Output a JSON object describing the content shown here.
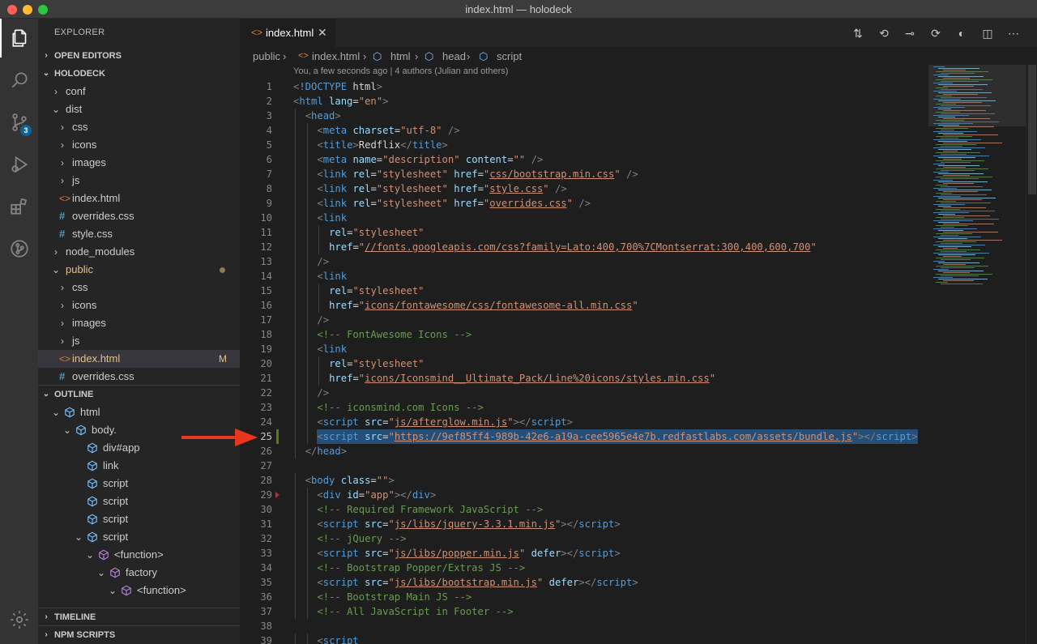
{
  "window": {
    "title": "index.html — holodeck"
  },
  "activity": {
    "scm_badge": "3"
  },
  "sidebar": {
    "header": "EXPLORER",
    "open_editors": "OPEN EDITORS",
    "project": "HOLODECK",
    "tree": [
      {
        "label": "conf",
        "kind": "folder",
        "open": false,
        "depth": 1
      },
      {
        "label": "dist",
        "kind": "folder",
        "open": true,
        "depth": 1
      },
      {
        "label": "css",
        "kind": "folder",
        "open": false,
        "depth": 2
      },
      {
        "label": "icons",
        "kind": "folder",
        "open": false,
        "depth": 2
      },
      {
        "label": "images",
        "kind": "folder",
        "open": false,
        "depth": 2
      },
      {
        "label": "js",
        "kind": "folder",
        "open": false,
        "depth": 2
      },
      {
        "label": "index.html",
        "kind": "html",
        "depth": 2
      },
      {
        "label": "overrides.css",
        "kind": "css",
        "depth": 2
      },
      {
        "label": "style.css",
        "kind": "css",
        "depth": 2
      },
      {
        "label": "node_modules",
        "kind": "folder",
        "open": false,
        "depth": 1
      },
      {
        "label": "public",
        "kind": "folder",
        "open": true,
        "depth": 1,
        "modified": true
      },
      {
        "label": "css",
        "kind": "folder",
        "open": false,
        "depth": 2
      },
      {
        "label": "icons",
        "kind": "folder",
        "open": false,
        "depth": 2
      },
      {
        "label": "images",
        "kind": "folder",
        "open": false,
        "depth": 2
      },
      {
        "label": "js",
        "kind": "folder",
        "open": false,
        "depth": 2
      },
      {
        "label": "index.html",
        "kind": "html",
        "depth": 2,
        "selected": true,
        "flag": "M"
      },
      {
        "label": "overrides.css",
        "kind": "css",
        "depth": 2
      }
    ],
    "outline_title": "OUTLINE",
    "outline": [
      {
        "label": "html",
        "depth": 1,
        "open": true,
        "icon": "element"
      },
      {
        "label": "body.",
        "depth": 2,
        "open": true,
        "icon": "element"
      },
      {
        "label": "div#app",
        "depth": 3,
        "icon": "element"
      },
      {
        "label": "link",
        "depth": 3,
        "icon": "element"
      },
      {
        "label": "script",
        "depth": 3,
        "icon": "element"
      },
      {
        "label": "script",
        "depth": 3,
        "icon": "element"
      },
      {
        "label": "script",
        "depth": 3,
        "icon": "element"
      },
      {
        "label": "script",
        "depth": 3,
        "open": true,
        "icon": "element"
      },
      {
        "label": "<function>",
        "depth": 4,
        "open": true,
        "icon": "function"
      },
      {
        "label": "factory",
        "depth": 5,
        "open": true,
        "icon": "function"
      },
      {
        "label": "<function>",
        "depth": 6,
        "open": true,
        "icon": "function"
      }
    ],
    "timeline": "TIMELINE",
    "npm_scripts": "NPM SCRIPTS"
  },
  "tab": {
    "label": "index.html"
  },
  "breadcrumb": [
    "public",
    "index.html",
    "html",
    "head",
    "script"
  ],
  "codelens": "You, a few seconds ago | 4 authors (Julian and others)",
  "colors": {
    "accent": "#0e639c",
    "selection": "#264f78",
    "arrow": "#e8361e"
  },
  "code_lines": [
    {
      "n": "1",
      "indent": 0,
      "tokens": [
        [
          "p",
          "<"
        ],
        [
          "k",
          "!DOCTYPE"
        ],
        [
          "d",
          " html"
        ],
        [
          "p",
          ">"
        ]
      ]
    },
    {
      "n": "2",
      "indent": 0,
      "tokens": [
        [
          "p",
          "<"
        ],
        [
          "k",
          "html"
        ],
        [
          "d",
          " "
        ],
        [
          "a",
          "lang"
        ],
        [
          "d",
          "="
        ],
        [
          "s",
          "\"en\""
        ],
        [
          "p",
          ">"
        ]
      ]
    },
    {
      "n": "3",
      "indent": 1,
      "tokens": [
        [
          "p",
          "<"
        ],
        [
          "k",
          "head"
        ],
        [
          "p",
          ">"
        ]
      ]
    },
    {
      "n": "4",
      "indent": 2,
      "tokens": [
        [
          "p",
          "<"
        ],
        [
          "k",
          "meta"
        ],
        [
          "d",
          " "
        ],
        [
          "a",
          "charset"
        ],
        [
          "d",
          "="
        ],
        [
          "s",
          "\"utf-8\""
        ],
        [
          "d",
          " "
        ],
        [
          "p",
          "/>"
        ]
      ]
    },
    {
      "n": "5",
      "indent": 2,
      "tokens": [
        [
          "p",
          "<"
        ],
        [
          "k",
          "title"
        ],
        [
          "p",
          ">"
        ],
        [
          "d",
          "Redflix"
        ],
        [
          "p",
          "</"
        ],
        [
          "k",
          "title"
        ],
        [
          "p",
          ">"
        ]
      ]
    },
    {
      "n": "6",
      "indent": 2,
      "tokens": [
        [
          "p",
          "<"
        ],
        [
          "k",
          "meta"
        ],
        [
          "d",
          " "
        ],
        [
          "a",
          "name"
        ],
        [
          "d",
          "="
        ],
        [
          "s",
          "\"description\""
        ],
        [
          "d",
          " "
        ],
        [
          "a",
          "content"
        ],
        [
          "d",
          "="
        ],
        [
          "s",
          "\"\""
        ],
        [
          "d",
          " "
        ],
        [
          "p",
          "/>"
        ]
      ]
    },
    {
      "n": "7",
      "indent": 2,
      "tokens": [
        [
          "p",
          "<"
        ],
        [
          "k",
          "link"
        ],
        [
          "d",
          " "
        ],
        [
          "a",
          "rel"
        ],
        [
          "d",
          "="
        ],
        [
          "s",
          "\"stylesheet\""
        ],
        [
          "d",
          " "
        ],
        [
          "a",
          "href"
        ],
        [
          "d",
          "="
        ],
        [
          "s",
          "\""
        ],
        [
          "u",
          "css/bootstrap.min.css"
        ],
        [
          "s",
          "\""
        ],
        [
          "d",
          " "
        ],
        [
          "p",
          "/>"
        ]
      ]
    },
    {
      "n": "8",
      "indent": 2,
      "tokens": [
        [
          "p",
          "<"
        ],
        [
          "k",
          "link"
        ],
        [
          "d",
          " "
        ],
        [
          "a",
          "rel"
        ],
        [
          "d",
          "="
        ],
        [
          "s",
          "\"stylesheet\""
        ],
        [
          "d",
          " "
        ],
        [
          "a",
          "href"
        ],
        [
          "d",
          "="
        ],
        [
          "s",
          "\""
        ],
        [
          "u",
          "style.css"
        ],
        [
          "s",
          "\""
        ],
        [
          "d",
          " "
        ],
        [
          "p",
          "/>"
        ]
      ]
    },
    {
      "n": "9",
      "indent": 2,
      "tokens": [
        [
          "p",
          "<"
        ],
        [
          "k",
          "link"
        ],
        [
          "d",
          " "
        ],
        [
          "a",
          "rel"
        ],
        [
          "d",
          "="
        ],
        [
          "s",
          "\"stylesheet\""
        ],
        [
          "d",
          " "
        ],
        [
          "a",
          "href"
        ],
        [
          "d",
          "="
        ],
        [
          "s",
          "\""
        ],
        [
          "u",
          "overrides.css"
        ],
        [
          "s",
          "\""
        ],
        [
          "d",
          " "
        ],
        [
          "p",
          "/>"
        ]
      ]
    },
    {
      "n": "10",
      "indent": 2,
      "tokens": [
        [
          "p",
          "<"
        ],
        [
          "k",
          "link"
        ]
      ]
    },
    {
      "n": "11",
      "indent": 3,
      "tokens": [
        [
          "a",
          "rel"
        ],
        [
          "d",
          "="
        ],
        [
          "s",
          "\"stylesheet\""
        ]
      ]
    },
    {
      "n": "12",
      "indent": 3,
      "tokens": [
        [
          "a",
          "href"
        ],
        [
          "d",
          "="
        ],
        [
          "s",
          "\""
        ],
        [
          "u",
          "//fonts.googleapis.com/css?family=Lato:400,700%7CMontserrat:300,400,600,700"
        ],
        [
          "s",
          "\""
        ]
      ]
    },
    {
      "n": "13",
      "indent": 2,
      "tokens": [
        [
          "p",
          "/>"
        ]
      ]
    },
    {
      "n": "14",
      "indent": 2,
      "tokens": [
        [
          "p",
          "<"
        ],
        [
          "k",
          "link"
        ]
      ]
    },
    {
      "n": "15",
      "indent": 3,
      "tokens": [
        [
          "a",
          "rel"
        ],
        [
          "d",
          "="
        ],
        [
          "s",
          "\"stylesheet\""
        ]
      ]
    },
    {
      "n": "16",
      "indent": 3,
      "tokens": [
        [
          "a",
          "href"
        ],
        [
          "d",
          "="
        ],
        [
          "s",
          "\""
        ],
        [
          "u",
          "icons/fontawesome/css/fontawesome-all.min.css"
        ],
        [
          "s",
          "\""
        ]
      ]
    },
    {
      "n": "17",
      "indent": 2,
      "tokens": [
        [
          "p",
          "/>"
        ]
      ]
    },
    {
      "n": "18",
      "indent": 2,
      "tokens": [
        [
          "c",
          "<!-- FontAwesome Icons -->"
        ]
      ]
    },
    {
      "n": "19",
      "indent": 2,
      "tokens": [
        [
          "p",
          "<"
        ],
        [
          "k",
          "link"
        ]
      ]
    },
    {
      "n": "20",
      "indent": 3,
      "tokens": [
        [
          "a",
          "rel"
        ],
        [
          "d",
          "="
        ],
        [
          "s",
          "\"stylesheet\""
        ]
      ]
    },
    {
      "n": "21",
      "indent": 3,
      "tokens": [
        [
          "a",
          "href"
        ],
        [
          "d",
          "="
        ],
        [
          "s",
          "\""
        ],
        [
          "u",
          "icons/Iconsmind__Ultimate_Pack/Line%20icons/styles.min.css"
        ],
        [
          "s",
          "\""
        ]
      ]
    },
    {
      "n": "22",
      "indent": 2,
      "tokens": [
        [
          "p",
          "/>"
        ]
      ]
    },
    {
      "n": "23",
      "indent": 2,
      "tokens": [
        [
          "c",
          "<!-- iconsmind.com Icons -->"
        ]
      ]
    },
    {
      "n": "24",
      "indent": 2,
      "tokens": [
        [
          "p",
          "<"
        ],
        [
          "k",
          "script"
        ],
        [
          "d",
          " "
        ],
        [
          "a",
          "src"
        ],
        [
          "d",
          "="
        ],
        [
          "s",
          "\""
        ],
        [
          "u",
          "js/afterglow.min.js"
        ],
        [
          "s",
          "\""
        ],
        [
          "p",
          "></"
        ],
        [
          "k",
          "script"
        ],
        [
          "p",
          ">"
        ]
      ]
    },
    {
      "n": "25",
      "indent": 2,
      "selected": true,
      "tokens": [
        [
          "p",
          "<"
        ],
        [
          "k",
          "script"
        ],
        [
          "d",
          " "
        ],
        [
          "a",
          "src"
        ],
        [
          "d",
          "="
        ],
        [
          "s",
          "\""
        ],
        [
          "u",
          "https://9ef85ff4-989b-42e6-a19a-cee5965e4e7b.redfastlabs.com/assets/bundle.js"
        ],
        [
          "s",
          "\""
        ],
        [
          "p",
          "></"
        ],
        [
          "k",
          "script"
        ],
        [
          "p",
          ">"
        ]
      ]
    },
    {
      "n": "26",
      "indent": 1,
      "tokens": [
        [
          "p",
          "</"
        ],
        [
          "k",
          "head"
        ],
        [
          "p",
          ">"
        ]
      ]
    },
    {
      "n": "27",
      "indent": 0,
      "tokens": []
    },
    {
      "n": "28",
      "indent": 1,
      "tokens": [
        [
          "p",
          "<"
        ],
        [
          "k",
          "body"
        ],
        [
          "d",
          " "
        ],
        [
          "a",
          "class"
        ],
        [
          "d",
          "="
        ],
        [
          "s",
          "\"\""
        ],
        [
          "p",
          ">"
        ]
      ]
    },
    {
      "n": "29",
      "indent": 2,
      "tokens": [
        [
          "p",
          "<"
        ],
        [
          "k",
          "div"
        ],
        [
          "d",
          " "
        ],
        [
          "a",
          "id"
        ],
        [
          "d",
          "="
        ],
        [
          "s",
          "\"app\""
        ],
        [
          "p",
          "></"
        ],
        [
          "k",
          "div"
        ],
        [
          "p",
          ">"
        ]
      ]
    },
    {
      "n": "30",
      "indent": 2,
      "tokens": [
        [
          "c",
          "<!-- Required Framework JavaScript -->"
        ]
      ]
    },
    {
      "n": "31",
      "indent": 2,
      "tokens": [
        [
          "p",
          "<"
        ],
        [
          "k",
          "script"
        ],
        [
          "d",
          " "
        ],
        [
          "a",
          "src"
        ],
        [
          "d",
          "="
        ],
        [
          "s",
          "\""
        ],
        [
          "u",
          "js/libs/jquery-3.3.1.min.js"
        ],
        [
          "s",
          "\""
        ],
        [
          "p",
          "></"
        ],
        [
          "k",
          "script"
        ],
        [
          "p",
          ">"
        ]
      ]
    },
    {
      "n": "32",
      "indent": 2,
      "tokens": [
        [
          "c",
          "<!-- jQuery -->"
        ]
      ]
    },
    {
      "n": "33",
      "indent": 2,
      "tokens": [
        [
          "p",
          "<"
        ],
        [
          "k",
          "script"
        ],
        [
          "d",
          " "
        ],
        [
          "a",
          "src"
        ],
        [
          "d",
          "="
        ],
        [
          "s",
          "\""
        ],
        [
          "u",
          "js/libs/popper.min.js"
        ],
        [
          "s",
          "\""
        ],
        [
          "d",
          " "
        ],
        [
          "a",
          "defer"
        ],
        [
          "p",
          "></"
        ],
        [
          "k",
          "script"
        ],
        [
          "p",
          ">"
        ]
      ]
    },
    {
      "n": "34",
      "indent": 2,
      "tokens": [
        [
          "c",
          "<!-- Bootstrap Popper/Extras JS -->"
        ]
      ]
    },
    {
      "n": "35",
      "indent": 2,
      "tokens": [
        [
          "p",
          "<"
        ],
        [
          "k",
          "script"
        ],
        [
          "d",
          " "
        ],
        [
          "a",
          "src"
        ],
        [
          "d",
          "="
        ],
        [
          "s",
          "\""
        ],
        [
          "u",
          "js/libs/bootstrap.min.js"
        ],
        [
          "s",
          "\""
        ],
        [
          "d",
          " "
        ],
        [
          "a",
          "defer"
        ],
        [
          "p",
          "></"
        ],
        [
          "k",
          "script"
        ],
        [
          "p",
          ">"
        ]
      ]
    },
    {
      "n": "36",
      "indent": 2,
      "tokens": [
        [
          "c",
          "<!-- Bootstrap Main JS -->"
        ]
      ]
    },
    {
      "n": "37",
      "indent": 2,
      "tokens": [
        [
          "c",
          "<!-- All JavaScript in Footer -->"
        ]
      ]
    },
    {
      "n": "38",
      "indent": 0,
      "tokens": []
    },
    {
      "n": "39",
      "indent": 2,
      "tokens": [
        [
          "p",
          "<"
        ],
        [
          "k",
          "script"
        ]
      ]
    }
  ]
}
